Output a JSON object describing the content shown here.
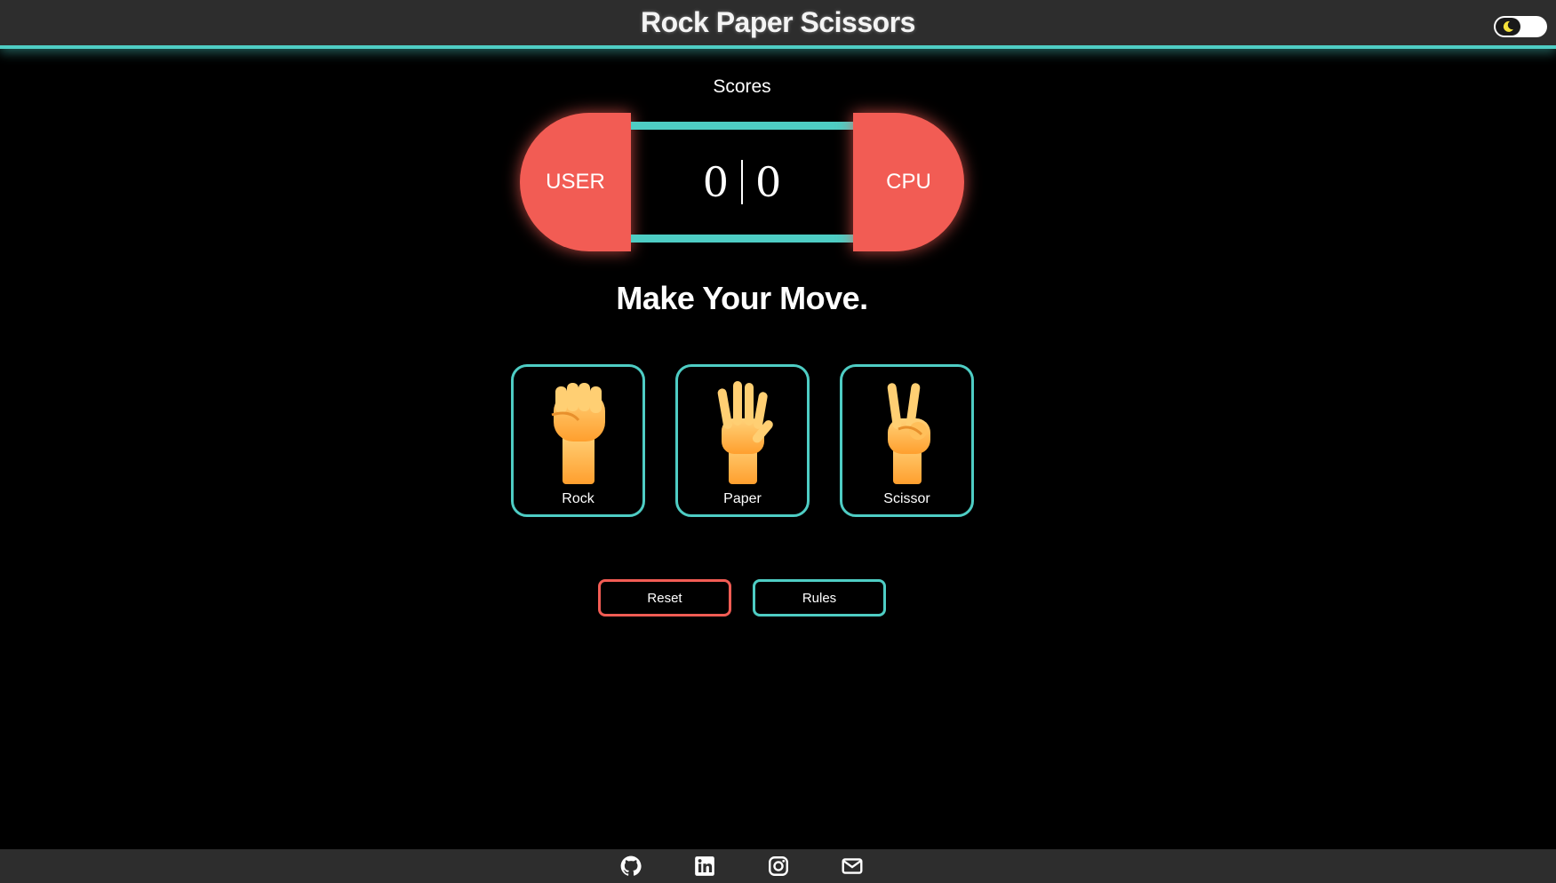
{
  "header": {
    "title": "Rock Paper Scissors",
    "theme_toggle_icon": "moon-icon"
  },
  "scores": {
    "label": "Scores",
    "user_label": "USER",
    "cpu_label": "CPU",
    "user_score": "0",
    "cpu_score": "0"
  },
  "headline": "Make Your Move.",
  "choices": [
    {
      "label": "Rock",
      "icon": "fist-icon"
    },
    {
      "label": "Paper",
      "icon": "open-hand-icon"
    },
    {
      "label": "Scissor",
      "icon": "victory-hand-icon"
    }
  ],
  "buttons": {
    "reset_label": "Reset",
    "rules_label": "Rules"
  },
  "footer": {
    "links": [
      "github-icon",
      "linkedin-icon",
      "instagram-icon",
      "mail-icon"
    ]
  },
  "colors": {
    "accent_teal": "#4ecdc4",
    "accent_red": "#f25c54",
    "bar_bg": "#2d2d2d",
    "page_bg": "#000000"
  }
}
